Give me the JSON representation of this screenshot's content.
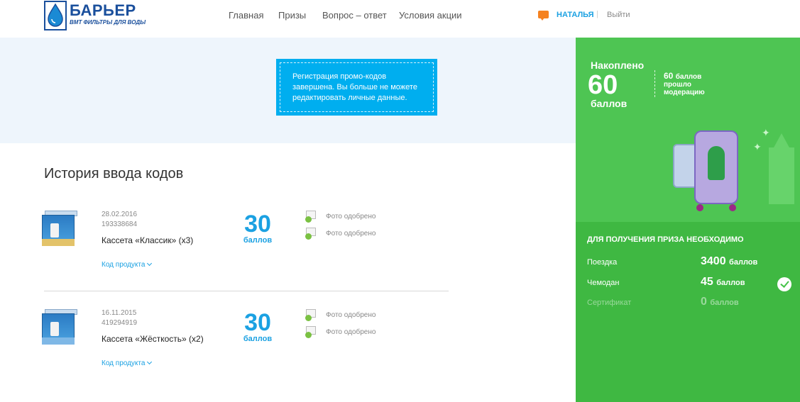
{
  "header": {
    "logo_title": "БАРЬЕР",
    "logo_subtitle": "ВМТ ФИЛЬТРЫ ДЛЯ ВОДЫ",
    "nav": [
      {
        "label": "Главная"
      },
      {
        "label": "Призы"
      },
      {
        "label": "Вопрос – ответ"
      },
      {
        "label": "Условия акции"
      }
    ],
    "user_name": "НАТАЛЬЯ",
    "separator": "|",
    "logout_label": "Выйти"
  },
  "notice": {
    "text_lines": [
      "Регистрация промо-кодов",
      "завершена. Вы больше не можете",
      "редактировать личные данные."
    ]
  },
  "history": {
    "title": "История ввода кодов",
    "entries": [
      {
        "date": "28.02.2016",
        "code": "193338684",
        "product_name": "Кассета «Классик» (x3)",
        "points": "30",
        "points_label": "баллов",
        "statuses": [
          "Фото одобрено",
          "Фото одобрено"
        ],
        "link_label": "Код продукта"
      },
      {
        "date": "16.11.2015",
        "code": "419294919",
        "product_name": "Кассета «Жёсткость» (x2)",
        "points": "30",
        "points_label": "баллов",
        "statuses": [
          "Фото одобрено",
          "Фото одобрено"
        ],
        "link_label": "Код продукта"
      }
    ]
  },
  "panel": {
    "accumulated_label": "Накоплено",
    "accumulated_value": "60",
    "accumulated_unit": "баллов",
    "moderation_value": "60",
    "moderation_unit": "баллов",
    "moderation_line1": "прошло",
    "moderation_line2": "модерацию",
    "requirements_title": "ДЛЯ ПОЛУЧЕНИЯ ПРИЗА НЕОБХОДИМО",
    "requirements": [
      {
        "name": "Поездка",
        "value": "3400",
        "unit": "баллов",
        "achieved": false,
        "dim": false
      },
      {
        "name": "Чемодан",
        "value": "45",
        "unit": "баллов",
        "achieved": true,
        "dim": false
      },
      {
        "name": "Сертификат",
        "value": "0",
        "unit": "баллов",
        "achieved": false,
        "dim": true
      }
    ]
  },
  "colors": {
    "accent_blue": "#1ba1e2",
    "notice_blue": "#00aeef",
    "panel_green": "#46c349",
    "chat_orange": "#f58220"
  }
}
